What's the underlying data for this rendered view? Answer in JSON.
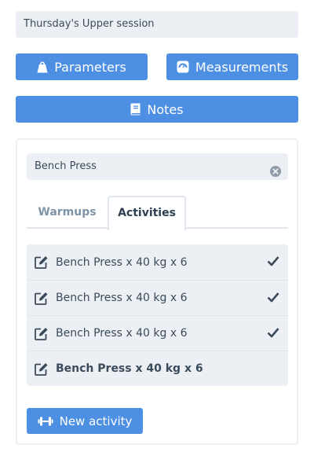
{
  "session": {
    "title": "Thursday's Upper session"
  },
  "buttons": {
    "parameters": "Parameters",
    "measurements": "Measurements",
    "notes": "Notes",
    "new_activity": "New activity"
  },
  "exercise": {
    "search_value": "Bench Press"
  },
  "tabs": [
    {
      "label": "Warmups",
      "active": false
    },
    {
      "label": "Activities",
      "active": true
    }
  ],
  "activities": [
    {
      "label": "Bench Press x 40 kg x 6",
      "done": true
    },
    {
      "label": "Bench Press x 40 kg x 6",
      "done": true
    },
    {
      "label": "Bench Press x 40 kg x 6",
      "done": true
    },
    {
      "label": "Bench Press x 40 kg x 6",
      "done": false
    }
  ],
  "colors": {
    "primary": "#4d8fe3",
    "field_bg": "#ecf0f4",
    "text": "#3b4a5a"
  },
  "icons": {
    "parameters": "weight-icon",
    "measurements": "scale-icon",
    "notes": "book-icon",
    "new_activity": "dumbbell-icon",
    "row_edit": "edit-icon",
    "row_done": "check-icon",
    "clear": "clear-icon"
  }
}
